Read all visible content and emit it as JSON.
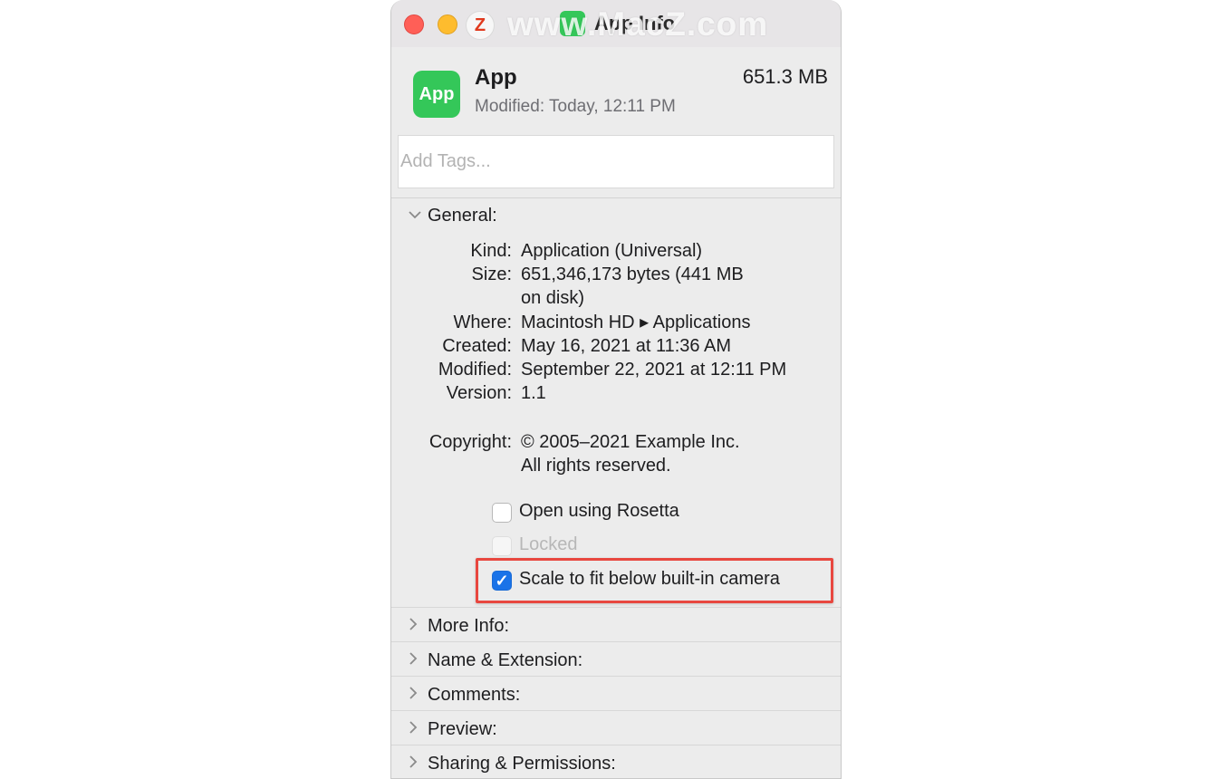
{
  "window": {
    "title": "App Info",
    "watermark": "www.MacZ.com",
    "logo_letter": "Z"
  },
  "header": {
    "app_icon_text": "App",
    "app_name": "App",
    "app_size": "651.3 MB",
    "modified": "Modified:  Today, 12:11 PM",
    "tags_placeholder": "Add Tags..."
  },
  "general": {
    "label": "General:",
    "rows": [
      {
        "label": "Kind:",
        "value": "Application (Universal)"
      },
      {
        "label": "Size:",
        "value": "651,346,173 bytes (441 MB",
        "value2": "on disk)"
      },
      {
        "label": "Where:",
        "value": "Macintosh HD ▸ Applications"
      },
      {
        "label": "Created:",
        "value": "May 16, 2021 at 11:36 AM"
      },
      {
        "label": "Modified:",
        "value": "September 22, 2021 at 12:11 PM"
      },
      {
        "label": "Version:",
        "value": "1.1"
      },
      {
        "label": "Copyright:",
        "value": "© 2005–2021 Example Inc.",
        "value2": "All rights reserved."
      }
    ],
    "checkboxes": [
      {
        "label": "Open using Rosetta",
        "checked": false,
        "enabled": true
      },
      {
        "label": "Locked",
        "checked": false,
        "enabled": false
      },
      {
        "label": "Scale to fit below built-in camera",
        "checked": true,
        "enabled": true
      }
    ]
  },
  "sections": [
    {
      "label": "More Info:"
    },
    {
      "label": "Name & Extension:"
    },
    {
      "label": "Comments:"
    },
    {
      "label": "Preview:"
    },
    {
      "label": "Sharing & Permissions:"
    }
  ],
  "colors": {
    "highlight_border": "#e8473f",
    "checkbox_checked": "#1a73e8",
    "app_icon": "#34c759",
    "close": "#ff5f57",
    "minimize": "#febc2e"
  }
}
